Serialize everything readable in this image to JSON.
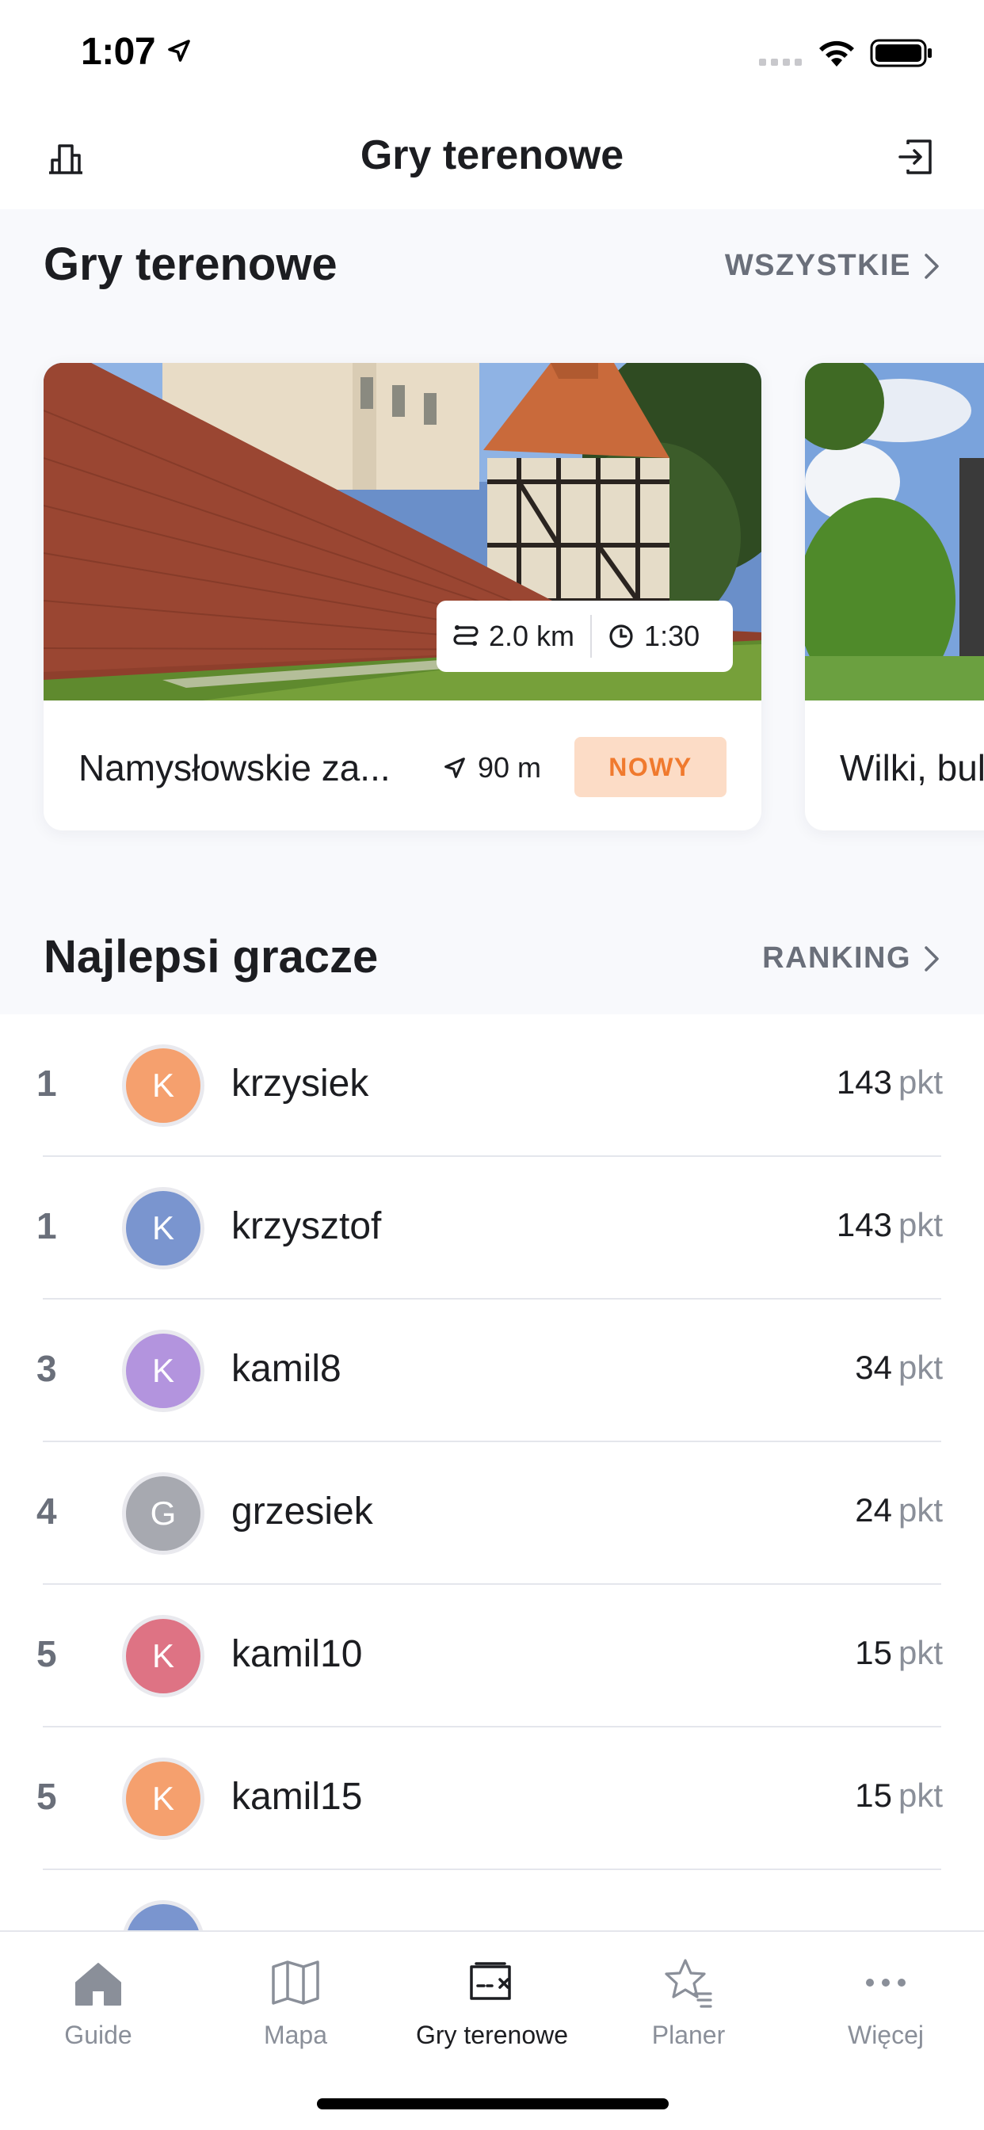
{
  "status_bar": {
    "time": "1:07"
  },
  "nav": {
    "title": "Gry terenowe",
    "left_icon": "leaderboard-icon",
    "right_icon": "logout-icon"
  },
  "games_section": {
    "title": "Gry terenowe",
    "link_label": "WSZYSTKIE",
    "cards": [
      {
        "name": "Namysłowskie za...",
        "route_length": "2.0 km",
        "duration": "1:30",
        "distance": "90 m",
        "badge": "NOWY"
      },
      {
        "name": "Wilki, bul"
      }
    ]
  },
  "players_section": {
    "title": "Najlepsi gracze",
    "link_label": "RANKING",
    "players": [
      {
        "rank": "1",
        "initial": "K",
        "name": "krzysiek",
        "points": "143",
        "unit": "pkt",
        "color": "#f5a06e"
      },
      {
        "rank": "1",
        "initial": "K",
        "name": "krzysztof",
        "points": "143",
        "unit": "pkt",
        "color": "#7a95cf"
      },
      {
        "rank": "3",
        "initial": "K",
        "name": "kamil8",
        "points": "34",
        "unit": "pkt",
        "color": "#b394de"
      },
      {
        "rank": "4",
        "initial": "G",
        "name": "grzesiek",
        "points": "24",
        "unit": "pkt",
        "color": "#a7a9b0"
      },
      {
        "rank": "5",
        "initial": "K",
        "name": "kamil10",
        "points": "15",
        "unit": "pkt",
        "color": "#de7384"
      },
      {
        "rank": "5",
        "initial": "K",
        "name": "kamil15",
        "points": "15",
        "unit": "pkt",
        "color": "#f5a06e"
      }
    ]
  },
  "tab_bar": {
    "tabs": [
      {
        "label": "Guide",
        "icon": "home-icon"
      },
      {
        "label": "Mapa",
        "icon": "map-icon"
      },
      {
        "label": "Gry terenowe",
        "icon": "field-game-icon",
        "active": true
      },
      {
        "label": "Planer",
        "icon": "planner-star-icon"
      },
      {
        "label": "Więcej",
        "icon": "more-icon"
      }
    ]
  },
  "colors": {
    "accent_orange": "#f07a2e",
    "badge_bg": "#fcdcc6",
    "muted": "#6a6f7a",
    "section_bg": "#f8f9fc"
  }
}
